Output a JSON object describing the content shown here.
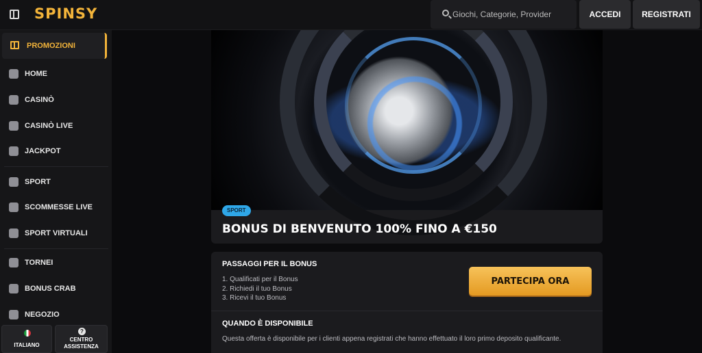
{
  "header": {
    "logo": "SPINSY",
    "search_placeholder": "Giochi, Categorie, Provider",
    "login_label": "ACCEDI",
    "register_label": "REGISTRATI"
  },
  "sidebar": {
    "promo": "PROMOZIONI",
    "items": [
      {
        "label": "HOME",
        "icon": "home-icon"
      },
      {
        "label": "CASINÒ",
        "icon": "slot-icon"
      },
      {
        "label": "CASINÒ LIVE",
        "icon": "live-casino-icon"
      },
      {
        "label": "JACKPOT",
        "icon": "clover-icon"
      },
      {
        "label": "SPORT",
        "icon": "soccer-ball-icon"
      },
      {
        "label": "SCOMMESSE LIVE",
        "icon": "live-icon"
      },
      {
        "label": "SPORT VIRTUALI",
        "icon": "virtual-sport-icon"
      },
      {
        "label": "TORNEI",
        "icon": "trophy-icon"
      },
      {
        "label": "BONUS CRAB",
        "icon": "crab-icon"
      },
      {
        "label": "NEGOZIO",
        "icon": "shop-icon"
      }
    ],
    "language_label": "ITALIANO",
    "help_label_1": "CENTRO",
    "help_label_2": "ASSISTENZA"
  },
  "hero": {
    "badge": "SPORT",
    "title": "BONUS DI BENVENUTO 100% FINO A €150"
  },
  "info": {
    "steps_title": "PASSAGGI PER IL BONUS",
    "steps": [
      "1. Qualificati per il Bonus",
      "2. Richiedi il tuo Bonus",
      "3. Ricevi il tuo Bonus"
    ],
    "cta_label": "PARTECIPA ORA",
    "availability_title": "QUANDO È DISPONIBILE",
    "availability_text": "Questa offerta è disponibile per i clienti appena registrati che hanno effettuato il loro primo deposito qualificante."
  },
  "colors": {
    "accent": "#f3b43a",
    "badge": "#2fa7e8",
    "background": "#0b0b0d"
  }
}
